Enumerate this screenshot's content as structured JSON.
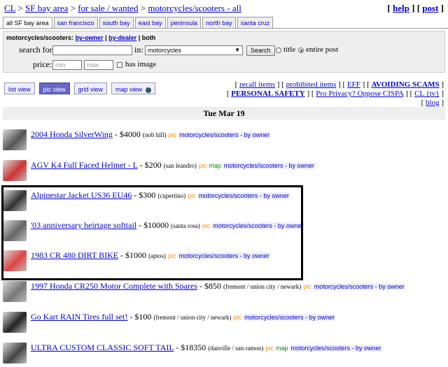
{
  "crumbs": {
    "cl": "CL",
    "sep1": ">",
    "area": "SF bay area",
    "sep2": ">",
    "section": "for sale / wanted",
    "sep3": ">",
    "category": "motorcycles/scooters - all"
  },
  "toplinks": {
    "open1": "[",
    "help": "help",
    "mid": "] [",
    "post": "post",
    "close": "]"
  },
  "tabs": [
    "all SF bay area",
    "san francisco",
    "south bay",
    "east bay",
    "peninsula",
    "north bay",
    "santa cruz"
  ],
  "search": {
    "heading": "motorcycles/scooters:",
    "by_owner": "by-owner",
    "sep": "|",
    "by_dealer": "by-dealer",
    "both": "| both",
    "search_for_label": "search for:",
    "in_label": "in:",
    "category_value": "motorcycles",
    "search_button": "Search",
    "title_label": "title",
    "entire_post_label": "entire post",
    "price_label": "price:",
    "min_placeholder": "min",
    "max_placeholder": "max",
    "has_image_label": "has image"
  },
  "views": {
    "list": "list view",
    "pic": "pic view",
    "grid": "grid view",
    "map": "map view"
  },
  "rlinks": {
    "recall": "recall items",
    "prohibited": "prohibited items",
    "eff": "EFF",
    "scams": "AVOIDING SCAMS",
    "safety": "PERSONAL SAFETY",
    "cispa": "Pro Privacy? Oppose CISPA",
    "tv": "CL {tv}",
    "blog": "blog"
  },
  "date": "Tue Mar 19",
  "listings": [
    {
      "title": "2004 Honda SilverWing",
      "price": "- $4000",
      "loc": "(nob hill)",
      "pic": "pic",
      "map": "",
      "cat": "motorcycles/scooters - by owner",
      "thumb": "#555"
    },
    {
      "title": "AGV K4 Full Faced Helmet - L",
      "price": "- $200",
      "loc": "(san leandro)",
      "pic": "pic",
      "map": "map",
      "cat": "motorcycles/scooters - by owner",
      "thumb": "#c33"
    },
    {
      "title": "Alpinestar Jacket US36 EU46",
      "price": "- $300",
      "loc": "(cupertino)",
      "pic": "pic",
      "map": "",
      "cat": "motorcycles/scooters - by owner",
      "thumb": "#333"
    },
    {
      "title": "'03 anniversary heirtage softtail",
      "price": "- $10000",
      "loc": "(santa rosa)",
      "pic": "pic",
      "map": "",
      "cat": "motorcycles/scooters - by owner",
      "thumb": "#666"
    },
    {
      "title": "1983 CR 480 DIRT BIKE",
      "price": "- $1000",
      "loc": "(aptos)",
      "pic": "pic",
      "map": "",
      "cat": "motorcycles/scooters - by owner",
      "thumb": "#d44"
    },
    {
      "title": "1997 Honda CR250 Motor Complete with Spares",
      "price": "- $850",
      "loc": "(fremont / union city / newark)",
      "pic": "pic",
      "map": "",
      "cat": "motorcycles/scooters - by owner",
      "thumb": "#777"
    },
    {
      "title": "Go Kart RAIN Tires full set!",
      "price": "- $100",
      "loc": "(fremont / union city / newark)",
      "pic": "pic",
      "map": "",
      "cat": "motorcycles/scooters - by owner",
      "thumb": "#222"
    },
    {
      "title": "ULTRA CUSTOM CLASSIC SOFT TAIL",
      "price": "- $18350",
      "loc": "(danville / san ramon)",
      "pic": "pic",
      "map": "map",
      "cat": "motorcycles/scooters - by owner",
      "thumb": "#444"
    }
  ]
}
